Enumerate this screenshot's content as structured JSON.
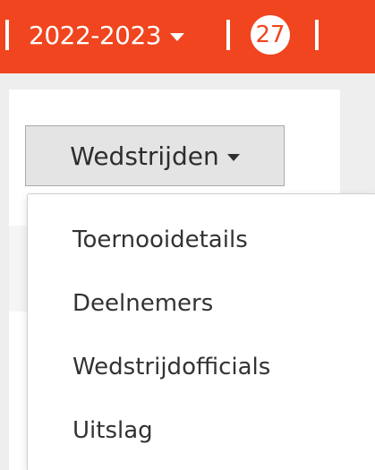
{
  "header": {
    "season_label": "2022-2023",
    "count_badge": "27"
  },
  "dropdown": {
    "label": "Wedstrijden",
    "items": [
      {
        "label": "Toernooidetails"
      },
      {
        "label": "Deelnemers"
      },
      {
        "label": "Wedstrijdofficials"
      },
      {
        "label": "Uitslag"
      }
    ]
  },
  "icons": {
    "season_caret": "caret-down-icon",
    "dropdown_caret": "caret-down-icon"
  },
  "colors": {
    "brand": "#f0451f",
    "page_background": "#eeeeee",
    "button_background": "#e4e4e4",
    "text": "#333333"
  }
}
